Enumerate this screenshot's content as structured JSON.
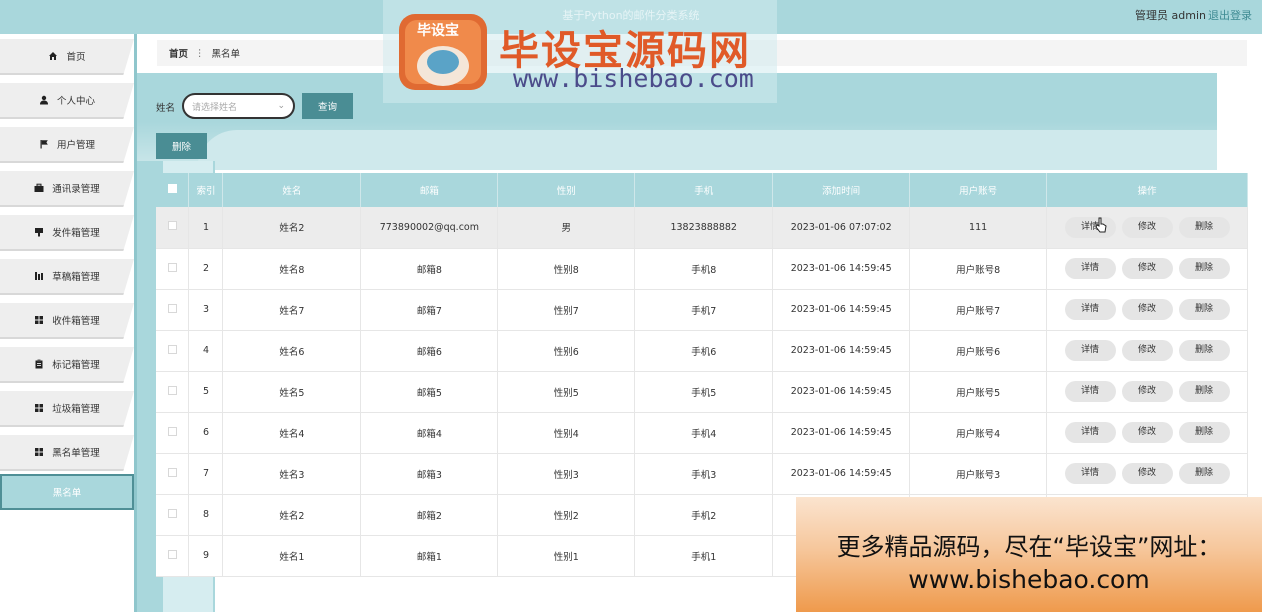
{
  "header": {
    "title": "基于Python的邮件分类系统",
    "user": "管理员 admin",
    "logout": "退出登录"
  },
  "sidebar": {
    "items": [
      {
        "label": "首页",
        "icon": "home-icon"
      },
      {
        "label": "个人中心",
        "icon": "user-icon"
      },
      {
        "label": "用户管理",
        "icon": "flag-icon"
      },
      {
        "label": "通讯录管理",
        "icon": "briefcase-icon"
      },
      {
        "label": "发件箱管理",
        "icon": "send-icon"
      },
      {
        "label": "草稿箱管理",
        "icon": "chart-icon"
      },
      {
        "label": "收件箱管理",
        "icon": "grid-icon"
      },
      {
        "label": "标记箱管理",
        "icon": "clipboard-icon"
      },
      {
        "label": "垃圾箱管理",
        "icon": "grid-icon"
      },
      {
        "label": "黑名单管理",
        "icon": "grid-icon"
      }
    ],
    "active_sub": "黑名单"
  },
  "breadcrumb": {
    "home": "首页",
    "separator": "⋮",
    "current": "黑名单"
  },
  "search": {
    "label": "姓名",
    "placeholder": "请选择姓名",
    "button": "查询"
  },
  "toolbar": {
    "delete": "删除"
  },
  "table": {
    "headers": [
      "索引",
      "姓名",
      "邮箱",
      "性别",
      "手机",
      "添加时间",
      "用户账号",
      "操作"
    ],
    "actions": {
      "detail": "详情",
      "edit": "修改",
      "delete": "删除"
    },
    "rows": [
      {
        "idx": "1",
        "name": "姓名2",
        "email": "773890002@qq.com",
        "gender": "男",
        "phone": "13823888882",
        "time": "2023-01-06 07:07:02",
        "account": "111"
      },
      {
        "idx": "2",
        "name": "姓名8",
        "email": "邮箱8",
        "gender": "性别8",
        "phone": "手机8",
        "time": "2023-01-06 14:59:45",
        "account": "用户账号8"
      },
      {
        "idx": "3",
        "name": "姓名7",
        "email": "邮箱7",
        "gender": "性别7",
        "phone": "手机7",
        "time": "2023-01-06 14:59:45",
        "account": "用户账号7"
      },
      {
        "idx": "4",
        "name": "姓名6",
        "email": "邮箱6",
        "gender": "性别6",
        "phone": "手机6",
        "time": "2023-01-06 14:59:45",
        "account": "用户账号6"
      },
      {
        "idx": "5",
        "name": "姓名5",
        "email": "邮箱5",
        "gender": "性别5",
        "phone": "手机5",
        "time": "2023-01-06 14:59:45",
        "account": "用户账号5"
      },
      {
        "idx": "6",
        "name": "姓名4",
        "email": "邮箱4",
        "gender": "性别4",
        "phone": "手机4",
        "time": "2023-01-06 14:59:45",
        "account": "用户账号4"
      },
      {
        "idx": "7",
        "name": "姓名3",
        "email": "邮箱3",
        "gender": "性别3",
        "phone": "手机3",
        "time": "2023-01-06 14:59:45",
        "account": "用户账号3"
      },
      {
        "idx": "8",
        "name": "姓名2",
        "email": "邮箱2",
        "gender": "性别2",
        "phone": "手机2",
        "time": "",
        "account": ""
      },
      {
        "idx": "9",
        "name": "姓名1",
        "email": "邮箱1",
        "gender": "性别1",
        "phone": "手机1",
        "time": "",
        "account": ""
      }
    ]
  },
  "watermark": {
    "logo_text": "毕设宝",
    "big_text": "毕设宝源码网",
    "url": "www.bishebao.com"
  },
  "ad": {
    "line1": "更多精品源码，尽在“毕设宝”网址：",
    "line2": "www.bishebao.com"
  },
  "colors": {
    "accent": "#a9d7dc",
    "button": "#4a8d94"
  }
}
